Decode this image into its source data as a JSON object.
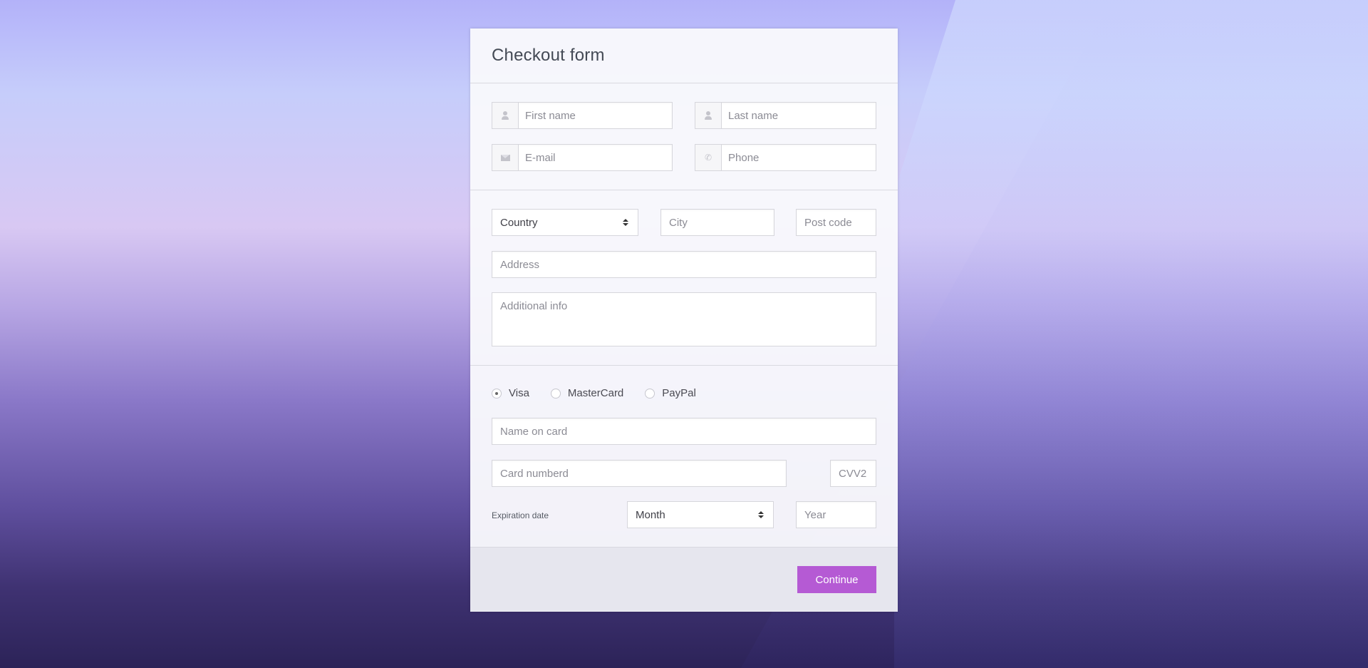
{
  "form": {
    "title": "Checkout form",
    "contact": {
      "first_name_placeholder": "First name",
      "last_name_placeholder": "Last name",
      "email_placeholder": "E-mail",
      "phone_placeholder": "Phone"
    },
    "address": {
      "country_selected": "Country",
      "city_placeholder": "City",
      "postcode_placeholder": "Post code",
      "address_placeholder": "Address",
      "additional_info_placeholder": "Additional info"
    },
    "payment": {
      "methods": [
        {
          "label": "Visa",
          "checked": true
        },
        {
          "label": "MasterCard",
          "checked": false
        },
        {
          "label": "PayPal",
          "checked": false
        }
      ],
      "name_on_card_placeholder": "Name on card",
      "card_number_placeholder": "Card numberd",
      "cvv_placeholder": "CVV2",
      "expiration_label": "Expiration date",
      "month_selected": "Month",
      "year_placeholder": "Year"
    },
    "continue_label": "Continue",
    "colors": {
      "accent": "#b55ad4"
    },
    "icons": {
      "first_name": "user-icon",
      "last_name": "user-icon",
      "email": "envelope-icon",
      "phone": "phone-icon"
    }
  }
}
